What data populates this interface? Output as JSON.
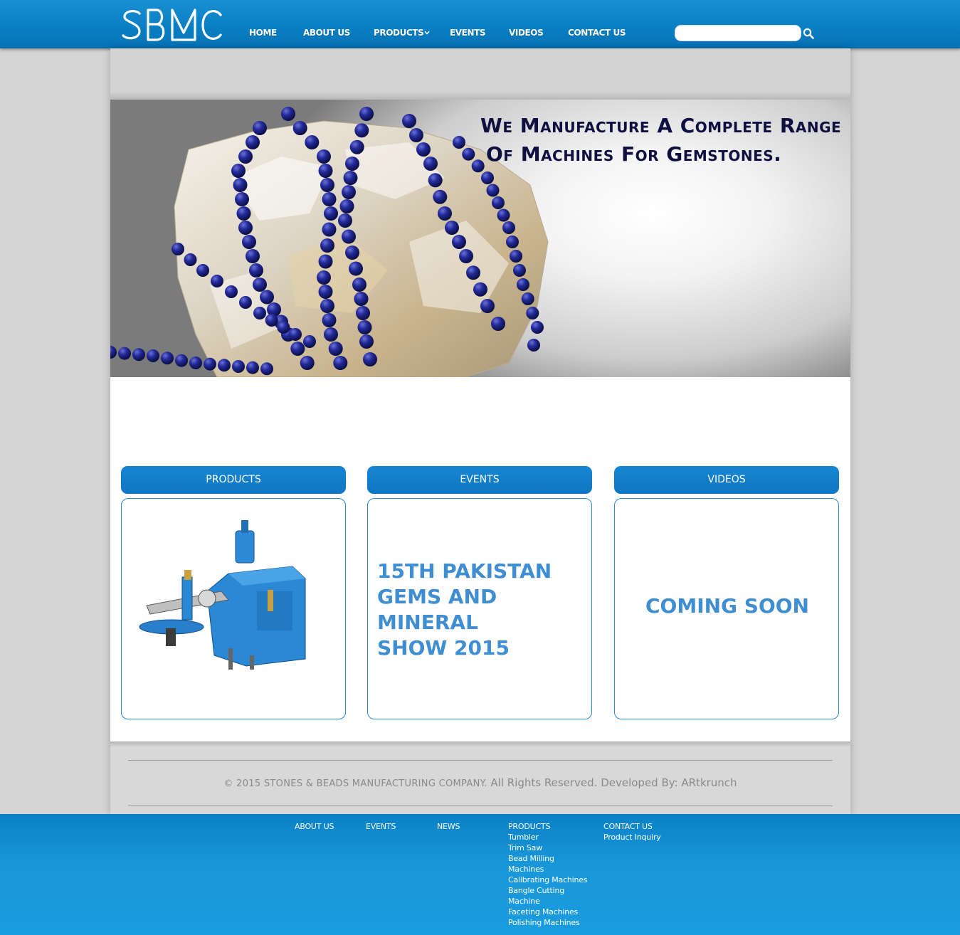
{
  "brand": {
    "logo_text": "SBMC"
  },
  "nav": {
    "home": "HOME",
    "about": "ABOUT US",
    "products": "PRODUCTS",
    "events": "EVENTS",
    "videos": "VIDEOS",
    "contact": "CONTACT US"
  },
  "search": {
    "placeholder": "",
    "value": ""
  },
  "banner": {
    "line1": "We Manufacture A Complete Range",
    "line2": "Of Machines For Gemstones."
  },
  "tiles": [
    {
      "title": "PRODUCTS"
    },
    {
      "title": "EVENTS",
      "content_lines": [
        "15TH PAKISTAN",
        "GEMS AND MINERAL",
        "SHOW 2015"
      ]
    },
    {
      "title": "VIDEOS",
      "content": "COMING SOON"
    }
  ],
  "copyright": {
    "company": "© 2015 STONES & BEADS MANUFACTURING COMPANY.",
    "rest": " All Rights Reserved. Developed By: ARtkrunch"
  },
  "footer": {
    "about": "ABOUT US",
    "events": "EVENTS",
    "news": "NEWS",
    "products_head": "PRODUCTS",
    "products": [
      "Tumbler",
      "Trim Saw",
      "Bead Milling",
      "Machines",
      "Calibrating Machines",
      "Bangle Cutting",
      "Machine",
      "Faceting Machines",
      "Polishing Machines"
    ],
    "contact_head": "CONTACT US",
    "contact_items": [
      "Product Inquiry"
    ]
  },
  "colors": {
    "header_blue": "#0b7fc4",
    "tile_text": "#3f8ed2",
    "bead_blue": "#1a1f7a"
  }
}
